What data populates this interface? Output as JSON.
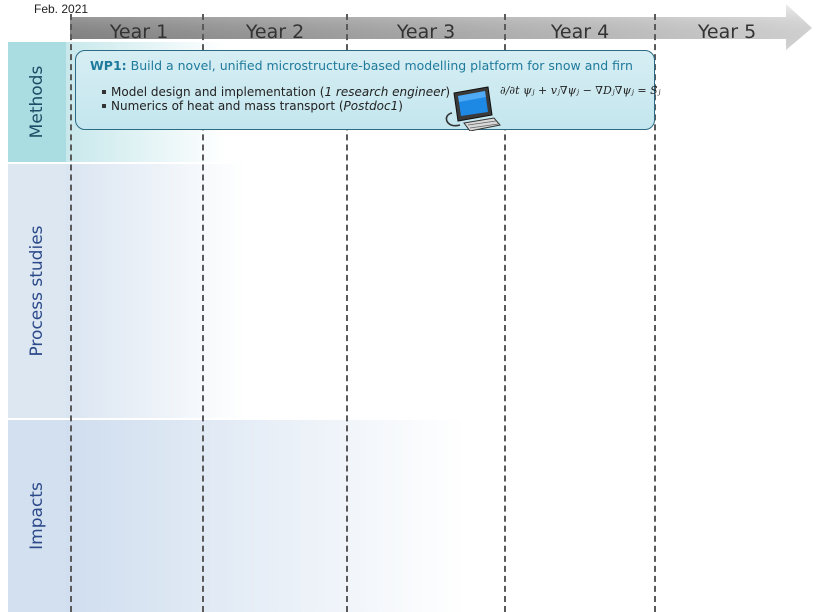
{
  "timeline": {
    "start_label": "Feb. 2021",
    "years": [
      "Year 1",
      "Year 2",
      "Year 3",
      "Year 4",
      "Year 5"
    ]
  },
  "rows": {
    "methods": "Methods",
    "process": "Process studies",
    "impacts": "Impacts"
  },
  "wp1": {
    "id": "WP1:",
    "title": "Build a novel, unified microstructure-based modelling platform for snow and firn",
    "bullets": [
      {
        "text": "Model design and implementation (",
        "italic": "1 research engineer",
        "end": ")"
      },
      {
        "text": "Numerics of heat and mass transport (",
        "italic": "Postdoc1",
        "end": ")"
      }
    ],
    "equation": "∂/∂t ψⱼ + vⱼ∇ψⱼ − ∇Dⱼ∇ψⱼ = Sⱼ",
    "icon": "computer-icon"
  },
  "colors": {
    "methods_band": "#a9dde2",
    "process_band": "#dde7f2",
    "impacts_band": "#d2e0ef",
    "wp_title": "#1f7a9c",
    "wp_border": "#2b6b86"
  }
}
